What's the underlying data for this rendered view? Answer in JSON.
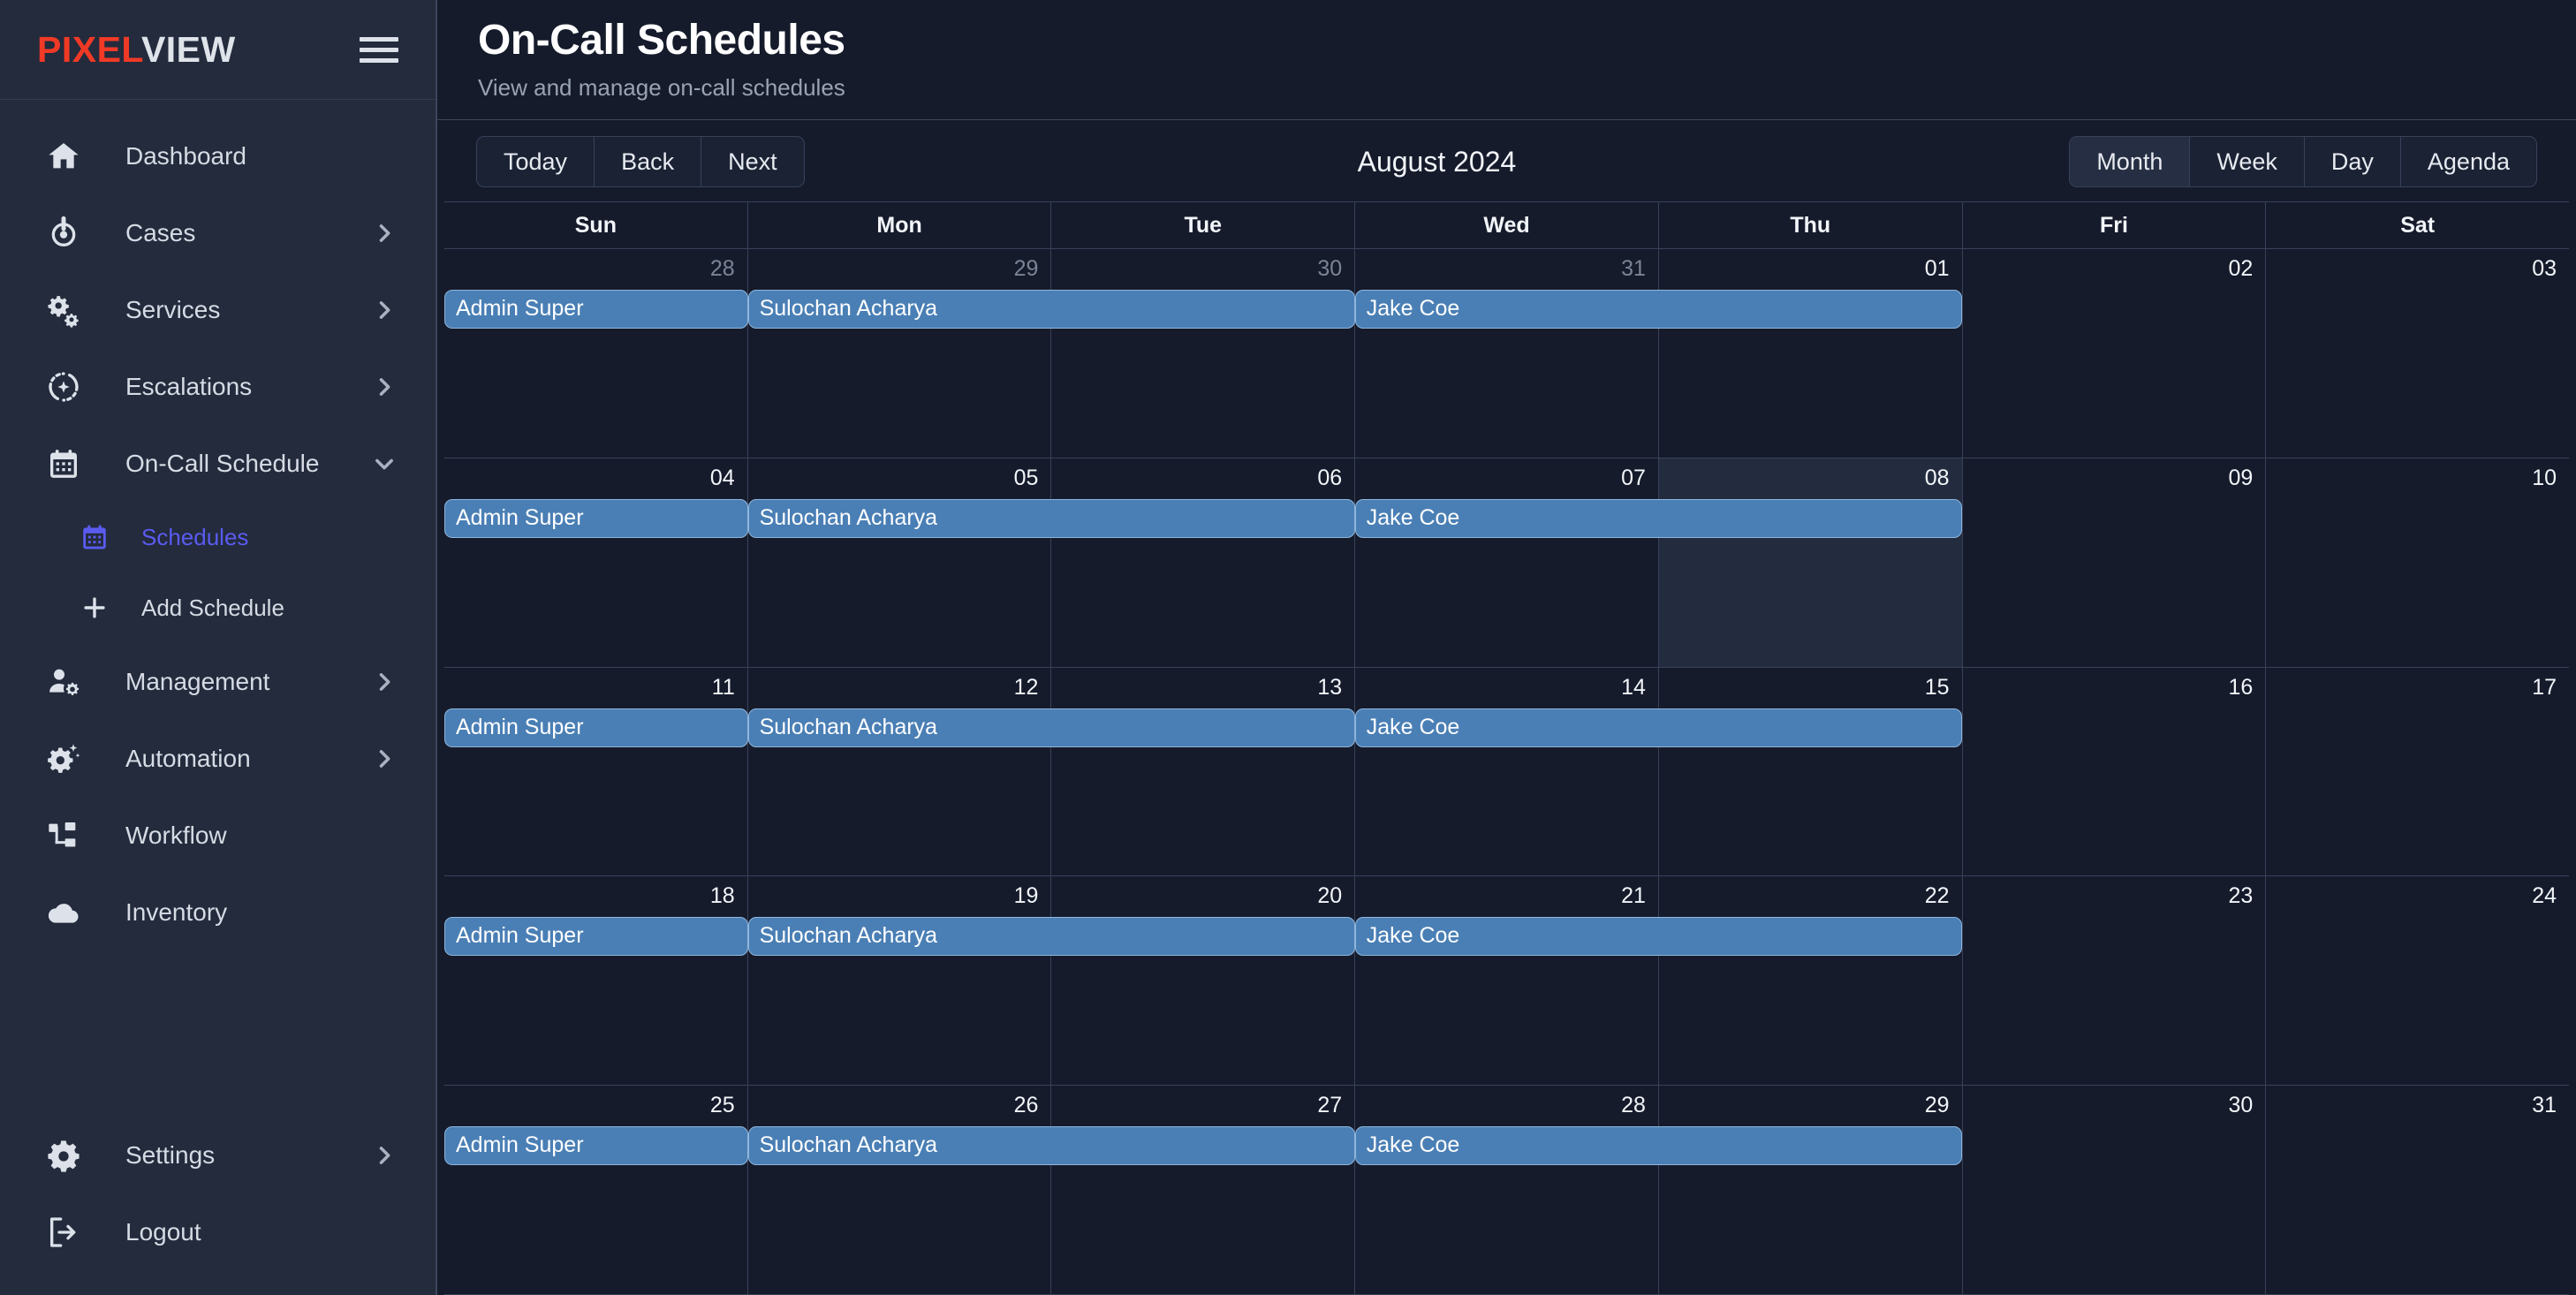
{
  "brand": {
    "part1": "PIXEL",
    "part2": "VIEW",
    "accent": "#f03a26"
  },
  "sidebar": {
    "hamburger_icon": "hamburger-icon",
    "items": [
      {
        "label": "Dashboard",
        "icon": "home-icon",
        "chevron": "none"
      },
      {
        "label": "Cases",
        "icon": "target-icon",
        "chevron": "right"
      },
      {
        "label": "Services",
        "icon": "gears-icon",
        "chevron": "right"
      },
      {
        "label": "Escalations",
        "icon": "refresh-spark-icon",
        "chevron": "right"
      },
      {
        "label": "On-Call Schedule",
        "icon": "calendar-icon",
        "chevron": "down"
      },
      {
        "label": "Management",
        "icon": "user-gear-icon",
        "chevron": "right"
      },
      {
        "label": "Automation",
        "icon": "gear-spark-icon",
        "chevron": "right"
      },
      {
        "label": "Workflow",
        "icon": "workflow-icon",
        "chevron": "none"
      },
      {
        "label": "Inventory",
        "icon": "cloud-icon",
        "chevron": "none"
      }
    ],
    "sub_items": [
      {
        "label": "Schedules",
        "icon": "calendar-icon",
        "active": true,
        "color": "#5b5bf0"
      },
      {
        "label": "Add Schedule",
        "icon": "plus-icon",
        "active": false,
        "color": "#d6dbe4"
      }
    ],
    "bottom_items": [
      {
        "label": "Settings",
        "icon": "gear-icon",
        "chevron": "right"
      },
      {
        "label": "Logout",
        "icon": "logout-icon",
        "chevron": "none"
      }
    ]
  },
  "header": {
    "title": "On-Call Schedules",
    "subtitle": "View and manage on-call schedules"
  },
  "toolbar": {
    "nav_buttons": [
      "Today",
      "Back",
      "Next"
    ],
    "current_label": "August 2024",
    "view_buttons": [
      "Month",
      "Week",
      "Day",
      "Agenda"
    ],
    "active_view": "Month"
  },
  "calendar": {
    "day_headers": [
      "Sun",
      "Mon",
      "Tue",
      "Wed",
      "Thu",
      "Fri",
      "Sat"
    ],
    "today_week": 1,
    "today_col": 4,
    "event_color": "#4a7fb5",
    "weeks": [
      {
        "days": [
          {
            "num": "28",
            "off": true
          },
          {
            "num": "29",
            "off": true
          },
          {
            "num": "30",
            "off": true
          },
          {
            "num": "31",
            "off": true
          },
          {
            "num": "01",
            "off": false
          },
          {
            "num": "02",
            "off": false
          },
          {
            "num": "03",
            "off": false
          }
        ],
        "events": [
          {
            "title": "Admin Super",
            "start": 0,
            "span": 1
          },
          {
            "title": "Sulochan Acharya",
            "start": 1,
            "span": 2
          },
          {
            "title": "Jake Coe",
            "start": 3,
            "span": 2
          }
        ]
      },
      {
        "days": [
          {
            "num": "04",
            "off": false
          },
          {
            "num": "05",
            "off": false
          },
          {
            "num": "06",
            "off": false
          },
          {
            "num": "07",
            "off": false
          },
          {
            "num": "08",
            "off": false
          },
          {
            "num": "09",
            "off": false
          },
          {
            "num": "10",
            "off": false
          }
        ],
        "events": [
          {
            "title": "Admin Super",
            "start": 0,
            "span": 1
          },
          {
            "title": "Sulochan Acharya",
            "start": 1,
            "span": 2
          },
          {
            "title": "Jake Coe",
            "start": 3,
            "span": 2
          }
        ]
      },
      {
        "days": [
          {
            "num": "11",
            "off": false
          },
          {
            "num": "12",
            "off": false
          },
          {
            "num": "13",
            "off": false
          },
          {
            "num": "14",
            "off": false
          },
          {
            "num": "15",
            "off": false
          },
          {
            "num": "16",
            "off": false
          },
          {
            "num": "17",
            "off": false
          }
        ],
        "events": [
          {
            "title": "Admin Super",
            "start": 0,
            "span": 1
          },
          {
            "title": "Sulochan Acharya",
            "start": 1,
            "span": 2
          },
          {
            "title": "Jake Coe",
            "start": 3,
            "span": 2
          }
        ]
      },
      {
        "days": [
          {
            "num": "18",
            "off": false
          },
          {
            "num": "19",
            "off": false
          },
          {
            "num": "20",
            "off": false
          },
          {
            "num": "21",
            "off": false
          },
          {
            "num": "22",
            "off": false
          },
          {
            "num": "23",
            "off": false
          },
          {
            "num": "24",
            "off": false
          }
        ],
        "events": [
          {
            "title": "Admin Super",
            "start": 0,
            "span": 1
          },
          {
            "title": "Sulochan Acharya",
            "start": 1,
            "span": 2
          },
          {
            "title": "Jake Coe",
            "start": 3,
            "span": 2
          }
        ]
      },
      {
        "days": [
          {
            "num": "25",
            "off": false
          },
          {
            "num": "26",
            "off": false
          },
          {
            "num": "27",
            "off": false
          },
          {
            "num": "28",
            "off": false
          },
          {
            "num": "29",
            "off": false
          },
          {
            "num": "30",
            "off": false
          },
          {
            "num": "31",
            "off": false
          }
        ],
        "events": [
          {
            "title": "Admin Super",
            "start": 0,
            "span": 1
          },
          {
            "title": "Sulochan Acharya",
            "start": 1,
            "span": 2
          },
          {
            "title": "Jake Coe",
            "start": 3,
            "span": 2
          }
        ]
      }
    ]
  }
}
